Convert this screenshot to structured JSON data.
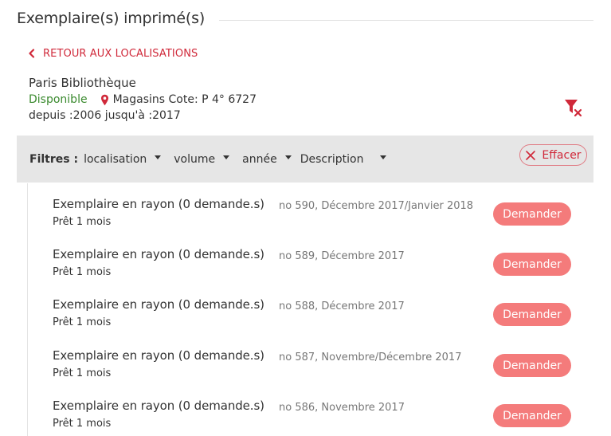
{
  "section": {
    "title": "Exemplaire(s) imprimé(s)"
  },
  "back_link": {
    "label": "RETOUR AUX LOCALISATIONS"
  },
  "library": {
    "name": "Paris Bibliothèque",
    "availability": "Disponible",
    "location": "Magasins Cote: P 4° 6727",
    "dates": "depuis :2006 jusqu'à :2017"
  },
  "filters": {
    "label": "Filtres :",
    "localisation": "localisation",
    "volume": "volume",
    "annee": "année",
    "description": "Description",
    "clear_label": "Effacer"
  },
  "colors": {
    "accent": "#d0293a",
    "available": "#3a8a2e",
    "button": "#f47b7b",
    "filter_bar": "#e6e6e6"
  },
  "icons": {
    "back": "chevron-left-icon",
    "location": "map-pin-icon",
    "filter_clear": "filter-remove-icon",
    "clear": "close-icon"
  },
  "items": [
    {
      "status": "Exemplaire en rayon (0 demande.s)",
      "loan": "Prêt 1 mois",
      "description": "no 590, Décembre 2017/Janvier 2018",
      "action": "Demander"
    },
    {
      "status": "Exemplaire en rayon (0 demande.s)",
      "loan": "Prêt 1 mois",
      "description": "no 589, Décembre 2017",
      "action": "Demander"
    },
    {
      "status": "Exemplaire en rayon (0 demande.s)",
      "loan": "Prêt 1 mois",
      "description": "no 588, Décembre 2017",
      "action": "Demander"
    },
    {
      "status": "Exemplaire en rayon (0 demande.s)",
      "loan": "Prêt 1 mois",
      "description": "no 587, Novembre/Décembre 2017",
      "action": "Demander"
    },
    {
      "status": "Exemplaire en rayon (0 demande.s)",
      "loan": "Prêt 1 mois",
      "description": "no 586, Novembre 2017",
      "action": "Demander"
    }
  ]
}
